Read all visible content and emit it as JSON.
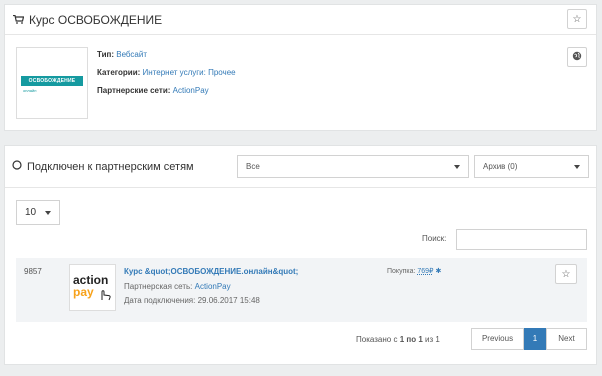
{
  "offer": {
    "title": "Курс ОСВОБОЖДЕНИЕ",
    "logo_text": "ОСВОБОЖДЕНИЕ",
    "logo_sub": "онлайн",
    "type_label": "Тип:",
    "type_value": "Вебсайт",
    "categories_label": "Категории:",
    "categories_value": "Интернет услуги: Прочее",
    "networks_label": "Партнерские сети:",
    "networks_value": "ActionPay"
  },
  "networks": {
    "title": "Подключен к партнерским сетям",
    "filter_selected": "Все",
    "archive_selected": "Архив (0)",
    "page_size": "10",
    "search_label": "Поиск:",
    "search_value": "",
    "rows": [
      {
        "id": "9857",
        "logo_line1": "action",
        "logo_line2": "pay",
        "name": "Курс &quot;ОСВОБОЖДЕНИЕ.онлайн&quot;",
        "network_label": "Партнерская сеть:",
        "network_value": "ActionPay",
        "date_label": "Дата подключения:",
        "date_value": "29.06.2017 15:48",
        "purchase_label": "Покупка:",
        "purchase_value": "769₽"
      }
    ],
    "pagination": {
      "info_prefix": "Показано с",
      "from": "1",
      "by": "по",
      "to": "1",
      "of": "из 1",
      "previous": "Previous",
      "current": "1",
      "next": "Next"
    }
  },
  "colors": {
    "accent": "#337ab7",
    "brand": "#159aa0",
    "actionpay": "#f7a21b"
  }
}
